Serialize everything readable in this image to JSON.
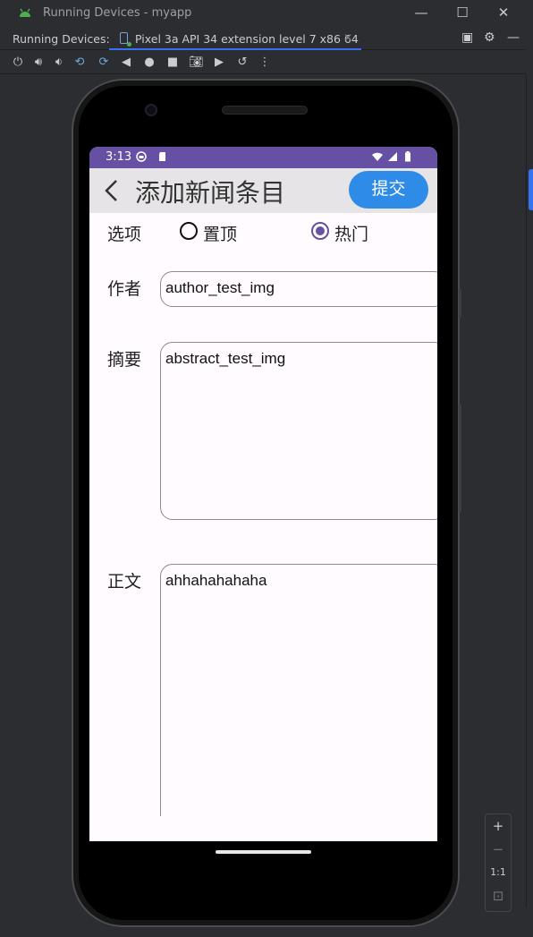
{
  "window": {
    "title": "Running Devices - myapp",
    "minimize": "—",
    "maximize": "☐",
    "close": "✕"
  },
  "tabs": {
    "label": "Running Devices:",
    "device_tab": "Pixel 3a API 34 extension level 7 x86 64",
    "close": "✕"
  },
  "toolbar_icons": [
    "power-icon",
    "volume-up-icon",
    "volume-down-icon",
    "rotate-left-icon",
    "rotate-right-icon",
    "back-icon",
    "home-icon",
    "overview-icon",
    "screenshot-icon",
    "screen-record-icon",
    "reset-icon",
    "more-icon"
  ],
  "zoom": {
    "plus": "+",
    "minus": "−",
    "ratio": "1:1"
  },
  "app": {
    "status_time": "3:13",
    "title": "添加新闻条目",
    "submit_label": "提交",
    "options_label": "选项",
    "option_top": "置顶",
    "option_hot": "热门",
    "option_hot_checked": true,
    "author_label": "作者",
    "author_value": "author_test_img",
    "abstract_label": "摘要",
    "abstract_value": "abstract_test_img",
    "body_label": "正文",
    "body_value": "ahhahahahaha"
  },
  "colors": {
    "statusbar": "#6650a4",
    "appbar": "#e6e4e7",
    "submit_button": "#2e8be8",
    "ide_background": "#2b2d30",
    "tab_underline": "#3574f0"
  }
}
